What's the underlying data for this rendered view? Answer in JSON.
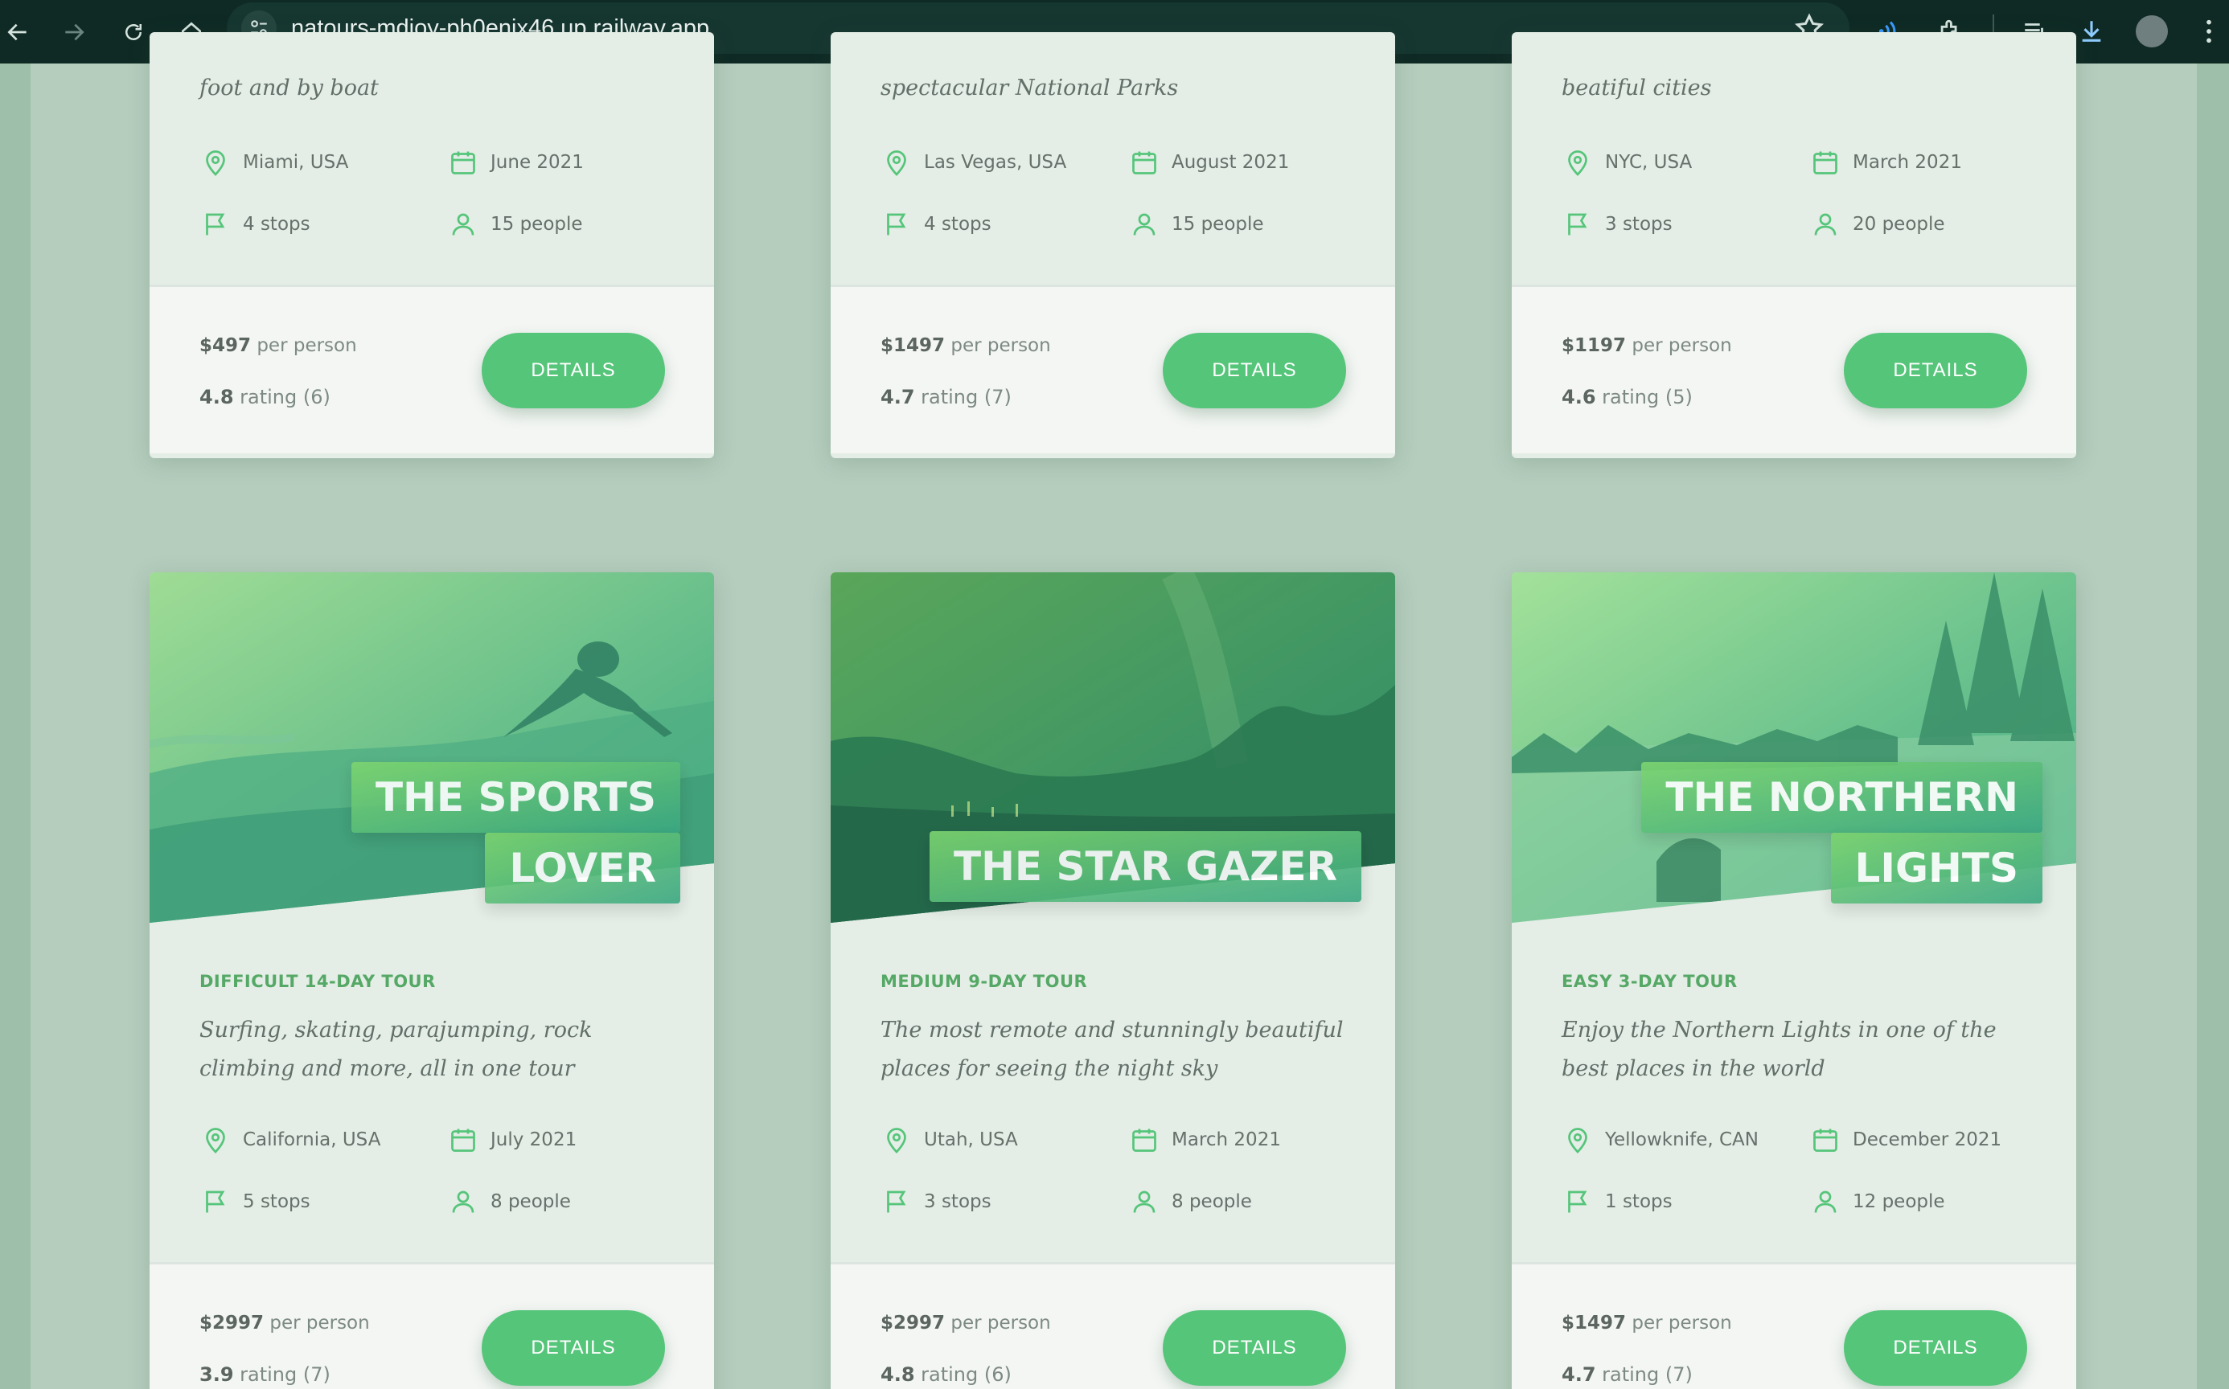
{
  "browser": {
    "url": "natours-mdjoy-ph0enix46.up.railway.app"
  },
  "colors": {
    "accent": "#55c57a",
    "accent_dark": "#28b485",
    "tour_difficulty": "#55a865",
    "background": "#b5cdbd"
  },
  "tours_top": [
    {
      "summary_tail": "foot and by boat",
      "location": "Miami, USA",
      "date": "June 2021",
      "stops": "4 stops",
      "people": "15 people",
      "price": "$497",
      "per_person": "per person",
      "rating_value": "4.8",
      "rating_rest": "rating (6)",
      "button": "DETAILS"
    },
    {
      "summary_tail": "spectacular National Parks",
      "location": "Las Vegas, USA",
      "date": "August 2021",
      "stops": "4 stops",
      "people": "15 people",
      "price": "$1497",
      "per_person": "per person",
      "rating_value": "4.7",
      "rating_rest": "rating (7)",
      "button": "DETAILS"
    },
    {
      "summary_tail": "beatiful cities",
      "location": "NYC, USA",
      "date": "March 2021",
      "stops": "3 stops",
      "people": "20 people",
      "price": "$1197",
      "per_person": "per person",
      "rating_value": "4.6",
      "rating_rest": "rating (5)",
      "button": "DETAILS"
    }
  ],
  "tours_bottom": [
    {
      "title_line1": "THE SPORTS",
      "title_line2": "LOVER",
      "difficulty": "DIFFICULT 14-DAY TOUR",
      "summary": "Surfing, skating, parajumping, rock climbing and more, all in one tour",
      "location": "California, USA",
      "date": "July 2021",
      "stops": "5 stops",
      "people": "8 people",
      "price": "$2997",
      "per_person": "per person",
      "rating_value": "3.9",
      "rating_rest": "rating (7)",
      "button": "DETAILS",
      "image": "surfer-photo"
    },
    {
      "title_line1": "THE STAR GAZER",
      "title_line2": "",
      "difficulty": "MEDIUM 9-DAY TOUR",
      "summary": "The most remote and stunningly beautiful places for seeing the night sky",
      "location": "Utah, USA",
      "date": "March 2021",
      "stops": "3 stops",
      "people": "8 people",
      "price": "$2997",
      "per_person": "per person",
      "rating_value": "4.8",
      "rating_rest": "rating (6)",
      "button": "DETAILS",
      "image": "night-sky-photo"
    },
    {
      "title_line1": "THE NORTHERN",
      "title_line2": "LIGHTS",
      "difficulty": "EASY 3-DAY TOUR",
      "summary": "Enjoy the Northern Lights in one of the best places in the world",
      "location": "Yellowknife, CAN",
      "date": "December 2021",
      "stops": "1 stops",
      "people": "12 people",
      "price": "$1497",
      "per_person": "per person",
      "rating_value": "4.7",
      "rating_rest": "rating (7)",
      "button": "DETAILS",
      "image": "snowy-forest-photo"
    }
  ]
}
